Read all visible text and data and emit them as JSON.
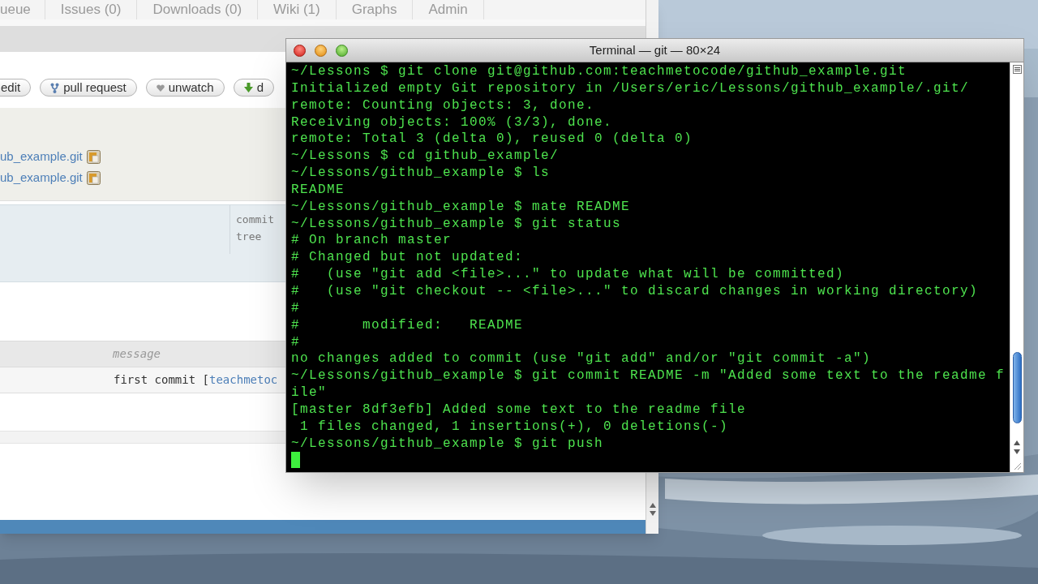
{
  "browser": {
    "tabs": [
      {
        "label": "ueue"
      },
      {
        "label": "Issues (0)"
      },
      {
        "label": "Downloads (0)"
      },
      {
        "label": "Wiki (1)"
      },
      {
        "label": "Graphs"
      },
      {
        "label": "Admin"
      }
    ],
    "buttons": [
      {
        "label": "edit",
        "kind": "plain"
      },
      {
        "label": "pull request",
        "kind": "fork"
      },
      {
        "label": "unwatch",
        "kind": "heart"
      },
      {
        "label": "d",
        "kind": "download"
      }
    ],
    "clone_urls": [
      "ub_example.git",
      "ub_example.git"
    ],
    "commit_labels": [
      "commit",
      "tree"
    ],
    "table": {
      "columns": [
        "message"
      ],
      "rows": [
        {
          "message": "first commit [",
          "link": "teachmetoc"
        }
      ]
    }
  },
  "terminal": {
    "title": "Terminal — git — 80×24",
    "lines": [
      "~/Lessons $ git clone git@github.com:teachmetocode/github_example.git",
      "Initialized empty Git repository in /Users/eric/Lessons/github_example/.git/",
      "remote: Counting objects: 3, done.",
      "Receiving objects: 100% (3/3), done.",
      "remote: Total 3 (delta 0), reused 0 (delta 0)",
      "~/Lessons $ cd github_example/",
      "~/Lessons/github_example $ ls",
      "README",
      "~/Lessons/github_example $ mate README",
      "~/Lessons/github_example $ git status",
      "# On branch master",
      "# Changed but not updated:",
      "#   (use \"git add <file>...\" to update what will be committed)",
      "#   (use \"git checkout -- <file>...\" to discard changes in working directory)",
      "#",
      "#       modified:   README",
      "#",
      "no changes added to commit (use \"git add\" and/or \"git commit -a\")",
      "~/Lessons/github_example $ git commit README -m \"Added some text to the readme f",
      "ile\"",
      "[master 8df3efb] Added some text to the readme file",
      " 1 files changed, 1 insertions(+), 0 deletions(-)",
      "~/Lessons/github_example $ git push"
    ]
  }
}
